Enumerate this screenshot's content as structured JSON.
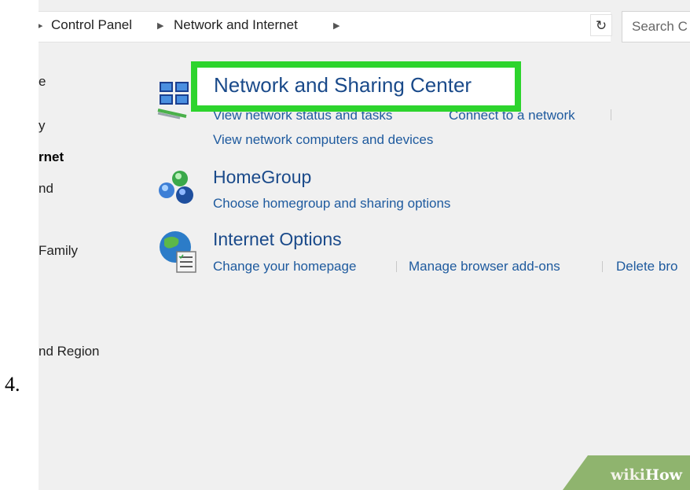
{
  "step": {
    "number": "4."
  },
  "address_bar": {
    "crumbs": [
      "Control Panel",
      "Network and Internet"
    ],
    "search_placeholder": "Search C"
  },
  "sidebar": {
    "items": [
      {
        "label": "e",
        "active": false
      },
      {
        "label": "y",
        "active": false
      },
      {
        "label": "rnet",
        "active": true
      },
      {
        "label": "nd",
        "active": false
      },
      {
        "label": "Family",
        "active": false
      },
      {
        "label": "nd Region",
        "active": false
      }
    ]
  },
  "categories": [
    {
      "icon": "network-sharing-icon",
      "title": "Network and Sharing Center",
      "links": [
        "View network status and tasks",
        "Connect to a network",
        "View network computers and devices"
      ]
    },
    {
      "icon": "homegroup-icon",
      "title": "HomeGroup",
      "links": [
        "Choose homegroup and sharing options"
      ]
    },
    {
      "icon": "internet-options-icon",
      "title": "Internet Options",
      "links": [
        "Change your homepage",
        "Manage browser add-ons",
        "Delete bro"
      ]
    }
  ],
  "watermark": {
    "wiki": "wiki",
    "how": "How",
    "color": "#8fb46e"
  },
  "highlight_color": "#2dd42d"
}
